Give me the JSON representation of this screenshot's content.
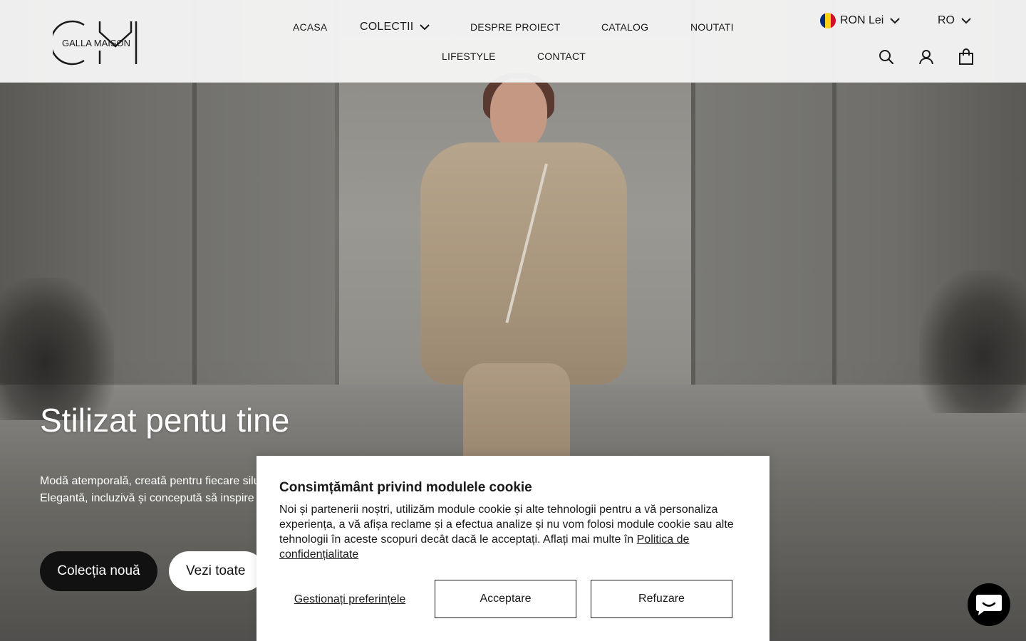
{
  "brand": {
    "logo_text": "GALLA MAISON",
    "logo_monogram": "GM"
  },
  "nav": {
    "row1": [
      "ACASA",
      "COLECTII",
      "DESPRE PROIECT",
      "CATALOG",
      "NOUTATI"
    ],
    "row2": [
      "LIFESTYLE",
      "CONTACT"
    ]
  },
  "utilities": {
    "currency": "RON Lei",
    "language": "RO",
    "icons": [
      "search-icon",
      "account-icon",
      "cart-icon"
    ]
  },
  "hero": {
    "title": "Stilizat pentu tine",
    "line1": "Modă atemporală, creată pentru fiecare silu",
    "line2": "Elegantă, incluzivă și concepută să inspire",
    "primary_button": "Colecția nouă",
    "secondary_button": "Vezi toate"
  },
  "cookie": {
    "title": "Consimțământ privind modulele cookie",
    "body": "Noi și partenerii noștri, utilizăm module cookie și alte tehnologii pentru a vă personaliza experiența, a vă afișa reclame și a efectua analize și nu vom folosi module cookie sau alte tehnologii în aceste scopuri decât dacă le acceptați. Aflați mai multe în ",
    "policy_link": "Politica de confidențialitate",
    "manage": "Gestionați preferințele",
    "accept": "Acceptare",
    "reject": "Refuzare"
  },
  "colors": {
    "flag_blue": "#002B7F",
    "flag_yellow": "#FCD116",
    "flag_red": "#CE1126",
    "dark_button": "#111111"
  }
}
